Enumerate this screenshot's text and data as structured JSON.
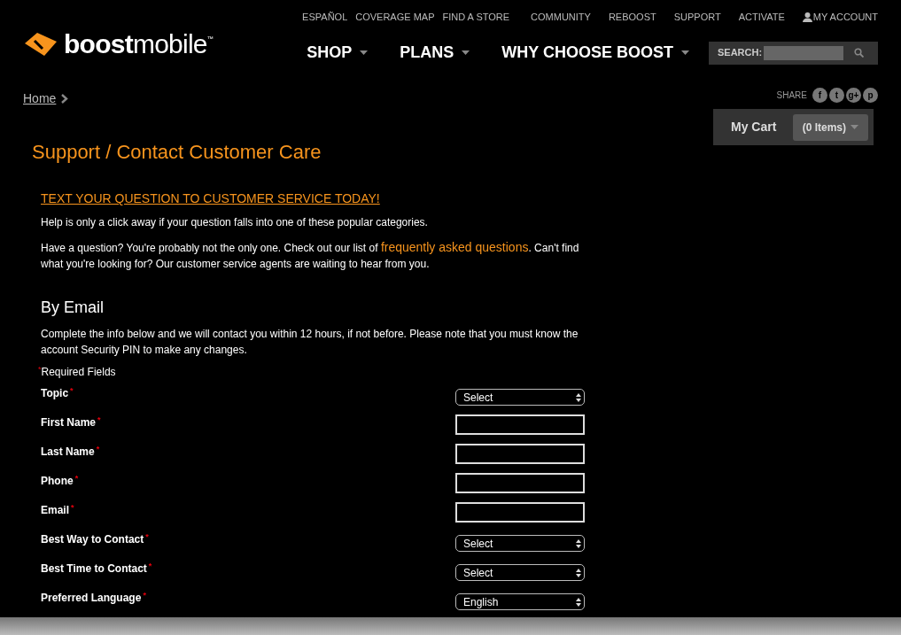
{
  "utility_nav": [
    "ESPAÑOL",
    "COVERAGE MAP",
    "FIND A STORE",
    "COMMUNITY",
    "REBOOST",
    "SUPPORT",
    "ACTIVATE",
    "MY ACCOUNT"
  ],
  "logo": {
    "bold": "boost",
    "light": "mobile",
    "trademark": "™"
  },
  "main_nav": [
    "SHOP",
    "PLANS",
    "WHY CHOOSE BOOST"
  ],
  "search": {
    "label": "SEARCH:"
  },
  "breadcrumb": [
    "Home"
  ],
  "share": {
    "label": "SHARE",
    "icons": [
      "f",
      "t",
      "g+",
      "p"
    ]
  },
  "cart": {
    "label": "My Cart",
    "items": "(0 Items)"
  },
  "page_title": "Support / Contact Customer Care",
  "text_link": "TEXT YOUR QUESTION TO CUSTOMER SERVICE TODAY!",
  "intro": "Help is only a click away if your question falls into one of these popular categories.",
  "faq_paragraph": {
    "before": "Have a question? You're probably not the only one. Check out our list of ",
    "link": "frequently asked questions",
    "after": ". Can't find what you're looking for? Our customer service agents are waiting to hear from you."
  },
  "email_section": {
    "heading": "By Email",
    "description": "Complete the info below and we will contact you within 12 hours, if not before. Please note that you must know the account Security PIN to make any changes.",
    "required_note": {
      "mark": "*",
      "text": "Required Fields"
    }
  },
  "fields": [
    {
      "label": "Topic",
      "mark": "*",
      "kind": "select",
      "value": "Select"
    },
    {
      "label": "First Name",
      "mark": "*",
      "kind": "text"
    },
    {
      "label": "Last Name",
      "mark": "*",
      "kind": "text"
    },
    {
      "label": "Phone",
      "mark": "*",
      "kind": "text"
    },
    {
      "label": "Email",
      "mark": "*",
      "kind": "text"
    },
    {
      "label": "Best Way to Contact",
      "mark": "*",
      "kind": "select",
      "value": "Select"
    },
    {
      "label": "Best Time to Contact",
      "mark": "*",
      "kind": "select",
      "value": "Select"
    },
    {
      "label": "Preferred Language",
      "mark": "*",
      "kind": "select",
      "value": "English"
    }
  ]
}
